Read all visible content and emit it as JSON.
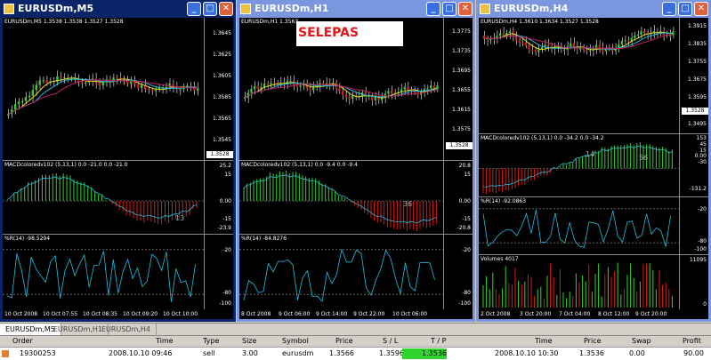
{
  "windows": [
    {
      "title": "EURUSDm,M5",
      "state": "active",
      "price_label": "EURUSDm,M5  1.3538 1.3538 1.3527 1.3528",
      "price_scale": [
        "1.3645",
        "1.3625",
        "1.3605",
        "1.3585",
        "1.3565",
        "1.3545"
      ],
      "current_price": "1.3528",
      "macd_label": "MACDcoloredv102 (5,13,1) 0.0 -21.0 0.0 -21.0",
      "macd_scale": [
        "25.2",
        "15",
        "0.00",
        "-15",
        "-23.9"
      ],
      "macd_annotation": "13",
      "wpr_label": "%R(14) -98.5294",
      "wpr_scale": [
        "-20",
        "-80",
        "-100"
      ],
      "time_labels": [
        "10 Oct 2008",
        "10 Oct 07:55",
        "10 Oct 08:35",
        "10 Oct 09:20",
        "10 Oct 10:00"
      ]
    },
    {
      "title": "EURUSDm,H1",
      "state": "inactive",
      "price_label": "EURUSDm,H1  1.3563",
      "annotation": "SELEPAS",
      "price_scale": [
        "1.3775",
        "1.3735",
        "1.3695",
        "1.3655",
        "1.3615",
        "1.3575"
      ],
      "current_price": "1.3528",
      "macd_label": "MACDcoloredv102 (5,13,1) 0.0 -9.4 0.0 -9.4",
      "macd_scale": [
        "20.8",
        "15",
        "0.00",
        "-15",
        "-20.8"
      ],
      "macd_annotation": "36",
      "wpr_label": "%R(14) -84.8276",
      "wpr_scale": [
        "-20",
        "-80",
        "-100"
      ],
      "time_labels": [
        "8 Oct 2008",
        "9 Oct 06:00",
        "9 Oct 14:00",
        "9 Oct 22:00",
        "10 Oct 06:00"
      ]
    },
    {
      "title": "EURUSDm,H4",
      "state": "inactive",
      "price_label": "EURUSDm,H4  1.3610 1.3634 1.3527 1.3528",
      "price_scale": [
        "1.3915",
        "1.3835",
        "1.3755",
        "1.3675",
        "1.3595",
        "1.3495"
      ],
      "current_price": "1.3528",
      "macd_label": "MACDcoloredv102 (5,13,1) 0.0 -34.2 0.0 -34.2",
      "macd_scale": [
        "153",
        "45",
        "15",
        "0.00",
        "-30",
        "-131.2"
      ],
      "macd_annotation_1": "14",
      "macd_annotation_2": "56",
      "wpr_label": "%R(14) -92.0863",
      "wpr_scale": [
        "-20",
        "-80",
        "-100"
      ],
      "volume_label": "Volumes 4017",
      "volume_scale": [
        "11095",
        "0"
      ],
      "time_labels": [
        "2 Oct 2008",
        "3 Oct 20:00",
        "7 Oct 04:00",
        "8 Oct 12:00",
        "9 Oct 20:00"
      ]
    }
  ],
  "chart_tabs": [
    "EURUSDm,M5",
    "EURUSDm,H1",
    "EURUSDm,H4"
  ],
  "terminal": {
    "columns": [
      "Order",
      "Time",
      "Type",
      "Size",
      "Symbol",
      "Price",
      "S / L",
      "T / P",
      "Time",
      "Price",
      "Swap",
      "Profit"
    ],
    "rows": [
      [
        "19300253",
        "2008.10.10 09:46",
        "sell",
        "3.00",
        "eurusdm",
        "1.3566",
        "1.3596",
        "1.3536",
        "2008.10.10 10:30",
        "1.3536",
        "0.00",
        "90.00"
      ]
    ]
  },
  "colors": {
    "active_title": "#0a246a",
    "inactive_title": "#7a96df",
    "bull_candle": "#2fd42f",
    "bear_candle": "#e01818",
    "tp_highlight": "#2fd42f"
  }
}
